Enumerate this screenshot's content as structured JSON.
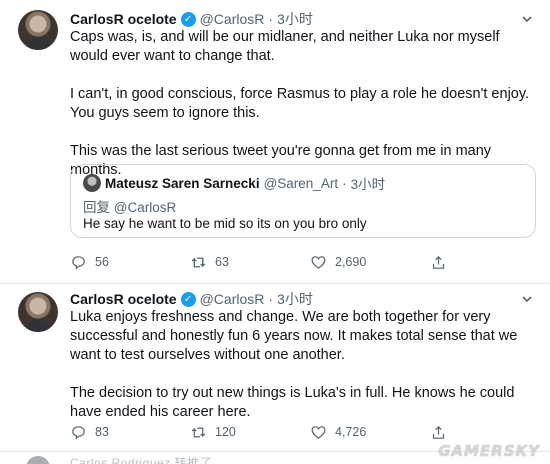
{
  "tweets": [
    {
      "author_name": "CarlosR ocelote",
      "author_handle": "@CarlosR",
      "separator": "·",
      "time": "3小时",
      "body": [
        "Caps was, is, and will be our midlaner, and neither Luka nor myself would ever want to change that.",
        "I can't, in good conscious, force Rasmus to play a role he doesn't enjoy. You guys seem to ignore this.",
        "This was the last serious tweet you're gonna get from me in many months."
      ],
      "quote": {
        "author_name": "Mateusz Saren Sarnecki",
        "author_handle": "@Saren_Art",
        "separator": "·",
        "time": "3小时",
        "reply_prefix": "回复",
        "reply_to": "@CarlosR",
        "text": "He say he want to be mid so its on you bro only"
      },
      "stats": {
        "replies": "56",
        "retweets": "63",
        "likes": "2,690"
      }
    },
    {
      "author_name": "CarlosR ocelote",
      "author_handle": "@CarlosR",
      "separator": "·",
      "time": "3小时",
      "body": [
        "Luka enjoys freshness and change. We are both together for very successful and honestly fun 6 years now. It makes total sense that we want to test ourselves without one another.",
        "The decision to try out new things is Luka's in full. He knows he could have ended his career here."
      ],
      "stats": {
        "replies": "83",
        "retweets": "120",
        "likes": "4,726"
      }
    }
  ],
  "peek_text": "Carlos Rodriguez 转推了",
  "watermark": "GAMERSKY",
  "icons": {
    "verified": "verified-badge-icon",
    "more": "chevron-down-icon",
    "reply": "reply-icon",
    "retweet": "retweet-icon",
    "like": "heart-icon",
    "share": "share-icon"
  },
  "colors": {
    "accent": "#1d9bf0",
    "muted": "#536471",
    "text": "#0f1419",
    "border": "#cfd9de"
  }
}
